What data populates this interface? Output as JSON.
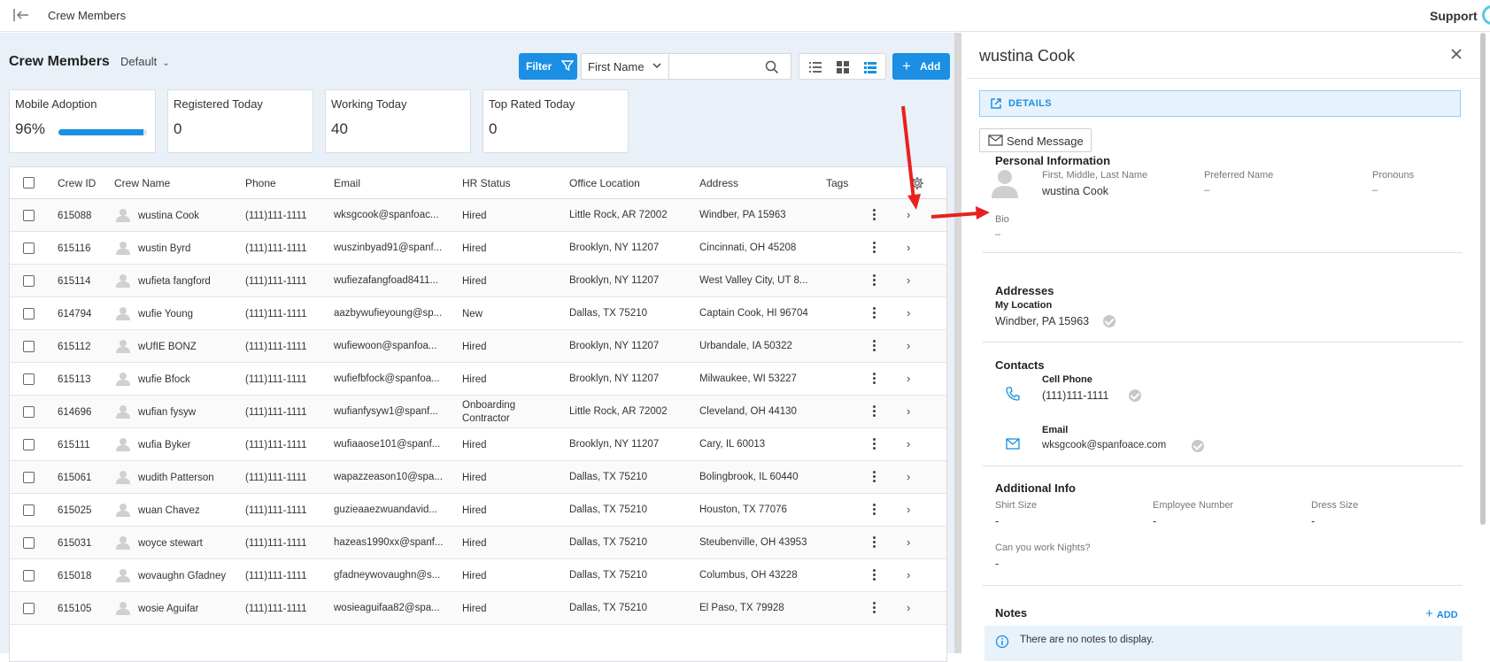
{
  "topbar": {
    "title": "Crew Members",
    "support": "Support"
  },
  "page": {
    "title": "Crew Members",
    "view": "Default"
  },
  "toolbar": {
    "filter_label": "Filter",
    "field_select": "First Name",
    "search_value": "",
    "add_label": "Add"
  },
  "stats": [
    {
      "label": "Mobile Adoption",
      "value": "96%",
      "progress": 0.96
    },
    {
      "label": "Registered Today",
      "value": "0"
    },
    {
      "label": "Working Today",
      "value": "40"
    },
    {
      "label": "Top Rated Today",
      "value": "0"
    }
  ],
  "table": {
    "headers": {
      "id": "Crew ID",
      "name": "Crew Name",
      "phone": "Phone",
      "email": "Email",
      "hr": "HR Status",
      "office": "Office Location",
      "address": "Address",
      "tags": "Tags"
    },
    "rows": [
      {
        "id": "615088",
        "name": "wustina Cook",
        "phone": "(111)111-1111",
        "email": "wksgcook@spanfoac...",
        "hr": "Hired",
        "hr2": "",
        "office": "Little Rock, AR 72002",
        "address": "Windber, PA 15963"
      },
      {
        "id": "615116",
        "name": "wustin Byrd",
        "phone": "(111)111-1111",
        "email": "wuszinbyad91@spanf...",
        "hr": "Hired",
        "hr2": "",
        "office": "Brooklyn, NY 11207",
        "address": "Cincinnati, OH 45208"
      },
      {
        "id": "615114",
        "name": "wufieta fangford",
        "phone": "(111)111-1111",
        "email": "wufiezafangfoad8411...",
        "hr": "Hired",
        "hr2": "",
        "office": "Brooklyn, NY 11207",
        "address": "West Valley City, UT 8..."
      },
      {
        "id": "614794",
        "name": "wufie Young",
        "phone": "(111)111-1111",
        "email": "aazbywufieyoung@sp...",
        "hr": "New",
        "hr2": "",
        "office": "Dallas, TX 75210",
        "address": "Captain Cook, HI 96704"
      },
      {
        "id": "615112",
        "name": "wUfIE BONZ",
        "phone": "(111)111-1111",
        "email": "wufiewoon@spanfoa...",
        "hr": "Hired",
        "hr2": "",
        "office": "Brooklyn, NY 11207",
        "address": "Urbandale, IA 50322"
      },
      {
        "id": "615113",
        "name": "wufie Bfock",
        "phone": "(111)111-1111",
        "email": "wufiefbfock@spanfoa...",
        "hr": "Hired",
        "hr2": "",
        "office": "Brooklyn, NY 11207",
        "address": "Milwaukee, WI 53227"
      },
      {
        "id": "614696",
        "name": "wufian fysyw",
        "phone": "(111)111-1111",
        "email": "wufianfysyw1@spanf...",
        "hr": "Onboarding",
        "hr2": "Contractor",
        "office": "Little Rock, AR 72002",
        "address": "Cleveland, OH 44130"
      },
      {
        "id": "615111",
        "name": "wufia Byker",
        "phone": "(111)111-1111",
        "email": "wufiaaose101@spanf...",
        "hr": "Hired",
        "hr2": "",
        "office": "Brooklyn, NY 11207",
        "address": "Cary, IL 60013"
      },
      {
        "id": "615061",
        "name": "wudith Patterson",
        "phone": "(111)111-1111",
        "email": "wapazzeason10@spa...",
        "hr": "Hired",
        "hr2": "",
        "office": "Dallas, TX 75210",
        "address": "Bolingbrook, IL 60440"
      },
      {
        "id": "615025",
        "name": "wuan Chavez",
        "phone": "(111)111-1111",
        "email": "guzieaaezwuandavid...",
        "hr": "Hired",
        "hr2": "",
        "office": "Dallas, TX 75210",
        "address": "Houston, TX 77076"
      },
      {
        "id": "615031",
        "name": "woyce stewart",
        "phone": "(111)111-1111",
        "email": "hazeas1990xx@spanf...",
        "hr": "Hired",
        "hr2": "",
        "office": "Dallas, TX 75210",
        "address": "Steubenville, OH 43953"
      },
      {
        "id": "615018",
        "name": "wovaughn Gfadney",
        "phone": "(111)111-1111",
        "email": "gfadneywovaughn@s...",
        "hr": "Hired",
        "hr2": "",
        "office": "Dallas, TX 75210",
        "address": "Columbus, OH 43228"
      },
      {
        "id": "615105",
        "name": "wosie Aguifar",
        "phone": "(111)111-1111",
        "email": "wosieaguifaa82@spa...",
        "hr": "Hired",
        "hr2": "",
        "office": "Dallas, TX 75210",
        "address": "El Paso, TX 79928"
      }
    ]
  },
  "panel": {
    "title": "wustina Cook",
    "details_label": "DETAILS",
    "send_message": "Send Message",
    "personal": {
      "title": "Personal Information",
      "name_label": "First, Middle, Last Name",
      "name_value": "wustina Cook",
      "preferred_label": "Preferred Name",
      "preferred_value": "–",
      "pronouns_label": "Pronouns",
      "pronouns_value": "–",
      "bio_label": "Bio",
      "bio_value": "–"
    },
    "addresses": {
      "title": "Addresses",
      "location_label": "My Location",
      "location_value": "Windber, PA 15963"
    },
    "contacts": {
      "title": "Contacts",
      "phone_label": "Cell Phone",
      "phone_value": "(111)111-1111",
      "email_label": "Email",
      "email_value": "wksgcook@spanfoace.com"
    },
    "additional": {
      "title": "Additional Info",
      "shirt_label": "Shirt Size",
      "shirt_value": "-",
      "employee_label": "Employee Number",
      "employee_value": "-",
      "dress_label": "Dress Size",
      "dress_value": "-",
      "nights_label": "Can you work Nights?",
      "nights_value": "-"
    },
    "notes": {
      "title": "Notes",
      "add_label": "ADD",
      "empty": "There are no notes to display."
    }
  },
  "colors": {
    "accent": "#1a8fe3",
    "annotation_arrow": "#e8211e"
  }
}
